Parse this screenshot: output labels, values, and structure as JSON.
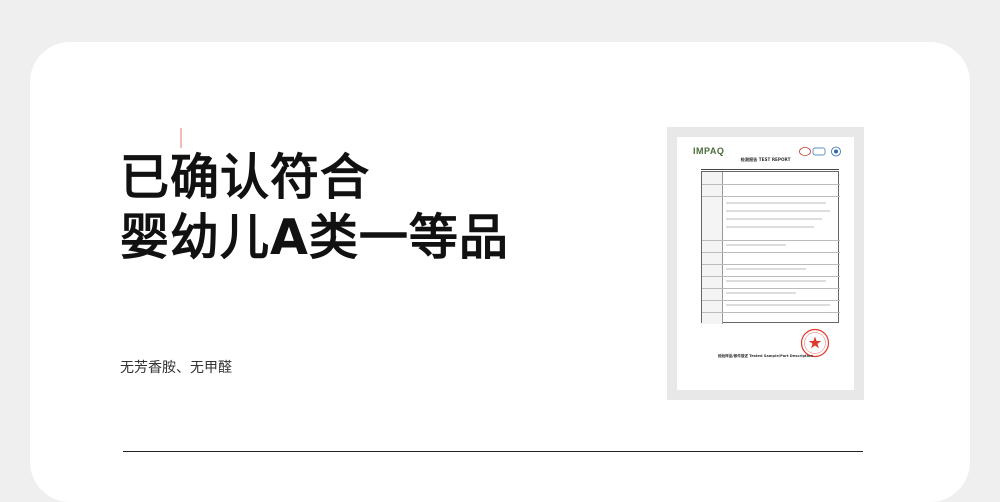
{
  "headline": {
    "line1": "已确认符合",
    "line2": "婴幼儿A类一等品"
  },
  "subtext": "无芳香胺、无甲醛",
  "certificate": {
    "logo": "IMPAQ",
    "title": "检测报告 TEST REPORT",
    "footer_title": "检验样品/部件描述 Tested Sample/Part Description",
    "marks": [
      "CMA",
      "CNAS"
    ],
    "stamp_color": "#e03a2e",
    "logo_color": "#4a6e3a"
  }
}
